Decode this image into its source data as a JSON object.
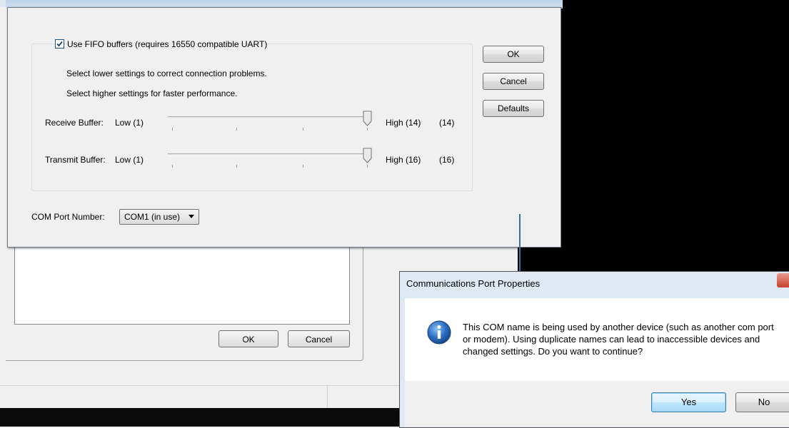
{
  "advanced_dialog": {
    "fifo": {
      "label": "Use FIFO buffers (requires 16550 compatible UART)",
      "checked": true
    },
    "hint_lower": "Select lower settings to correct connection problems.",
    "hint_higher": "Select higher settings for faster performance.",
    "receive": {
      "label": "Receive Buffer:",
      "low": "Low (1)",
      "high": "High (14)",
      "value": "(14)",
      "level": 1.0
    },
    "transmit": {
      "label": "Transmit Buffer:",
      "low": "Low (1)",
      "high": "High (16)",
      "value": "(16)",
      "level": 1.0
    },
    "com_port": {
      "label": "COM Port Number:",
      "selected": "COM1 (in use)"
    },
    "buttons": {
      "ok": "OK",
      "cancel": "Cancel",
      "defaults": "Defaults"
    }
  },
  "background_window": {
    "buttons": {
      "ok": "OK",
      "cancel": "Cancel"
    }
  },
  "message_dialog": {
    "title": "Communications Port Properties",
    "message": "This COM name is being used by another device (such as another com port or modem).  Using duplicate names can lead to inaccessible devices and changed settings.  Do you want to continue?",
    "icon": "info-icon",
    "buttons": {
      "yes": "Yes",
      "no": "No"
    }
  },
  "colors": {
    "info_icon": "#2a6ec3",
    "focus_border": "#3c7fb1"
  }
}
